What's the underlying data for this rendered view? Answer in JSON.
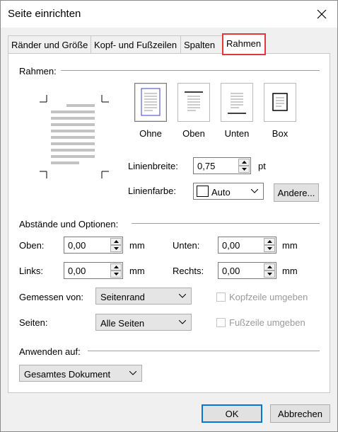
{
  "window": {
    "title": "Seite einrichten"
  },
  "tabs": [
    {
      "label": "Ränder und Größe",
      "active": false
    },
    {
      "label": "Kopf- und Fußzeilen",
      "active": false
    },
    {
      "label": "Spalten",
      "active": false
    },
    {
      "label": "Rahmen",
      "active": true
    }
  ],
  "rahmen": {
    "section_label": "Rahmen:",
    "presets": [
      {
        "label": "Ohne",
        "icon": "border-none-icon"
      },
      {
        "label": "Oben",
        "icon": "border-top-icon"
      },
      {
        "label": "Unten",
        "icon": "border-bottom-icon"
      },
      {
        "label": "Box",
        "icon": "border-box-icon"
      }
    ],
    "line_width_label": "Linienbreite:",
    "line_width_value": "0,75",
    "line_width_unit": "pt",
    "line_color_label": "Linienfarbe:",
    "line_color_value": "Auto",
    "more_button": "Andere..."
  },
  "options": {
    "section_label": "Abstände und Optionen:",
    "top_label": "Oben:",
    "top_value": "0,00",
    "bottom_label": "Unten:",
    "bottom_value": "0,00",
    "left_label": "Links:",
    "left_value": "0,00",
    "right_label": "Rechts:",
    "right_value": "0,00",
    "unit": "mm",
    "measured_label": "Gemessen von:",
    "measured_value": "Seitenrand",
    "pages_label": "Seiten:",
    "pages_value": "Alle Seiten",
    "header_check": "Kopfzeile umgeben",
    "footer_check": "Fußzeile umgeben"
  },
  "apply": {
    "label": "Anwenden auf:",
    "value": "Gesamtes Dokument"
  },
  "footer": {
    "ok": "OK",
    "cancel": "Abbrechen"
  },
  "colors": {
    "accent": "#0078d7",
    "highlight": "#e2383c"
  }
}
